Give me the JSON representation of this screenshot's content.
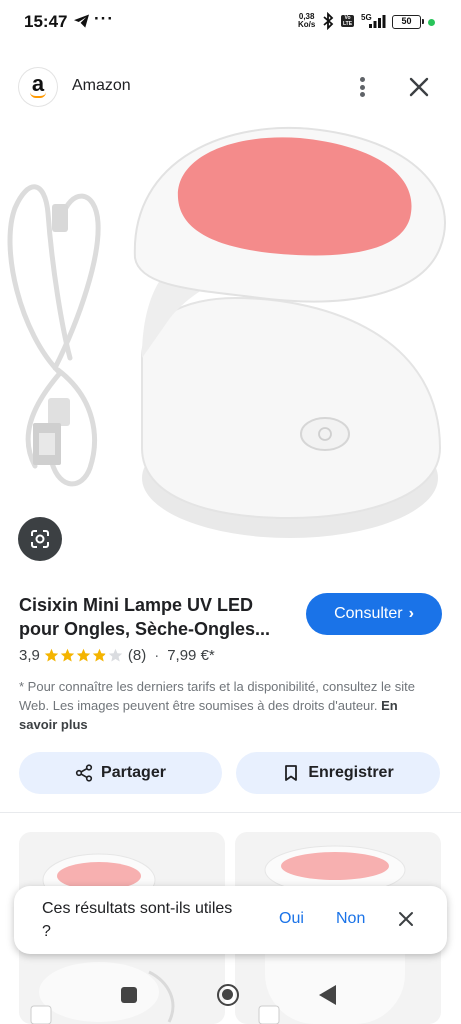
{
  "status_bar": {
    "time": "15:47",
    "dots": "···",
    "net_speed_value": "0,38",
    "net_speed_unit": "Ko/s",
    "volte": "Vo LTE",
    "network": "5G",
    "battery": "50"
  },
  "header": {
    "source_name": "Amazon",
    "logo_letter": "a"
  },
  "product": {
    "title_line1": "Cisixin Mini Lampe UV LED",
    "title_line2": "pour Ongles, Sèche-Ongles...",
    "consult_label": "Consulter",
    "rating_value": "3,9",
    "rating_stars": 3.9,
    "rating_max": 5,
    "review_count": "(8)",
    "separator": "·",
    "price": "7,99 €*",
    "disclaimer": "* Pour connaître les derniers tarifs et la disponibilité, consultez le site Web. Les images peuvent être soumises à des droits d'auteur.",
    "learn_more": "En savoir plus"
  },
  "actions": {
    "share_label": "Partager",
    "save_label": "Enregistrer"
  },
  "feedback": {
    "question": "Ces résultats sont-ils utiles ?",
    "yes": "Oui",
    "no": "Non"
  },
  "colors": {
    "accent": "#1a73e8",
    "pill_bg": "#e8f0fe",
    "star": "#f4b400",
    "lamp_pink": "#f48b8b"
  }
}
